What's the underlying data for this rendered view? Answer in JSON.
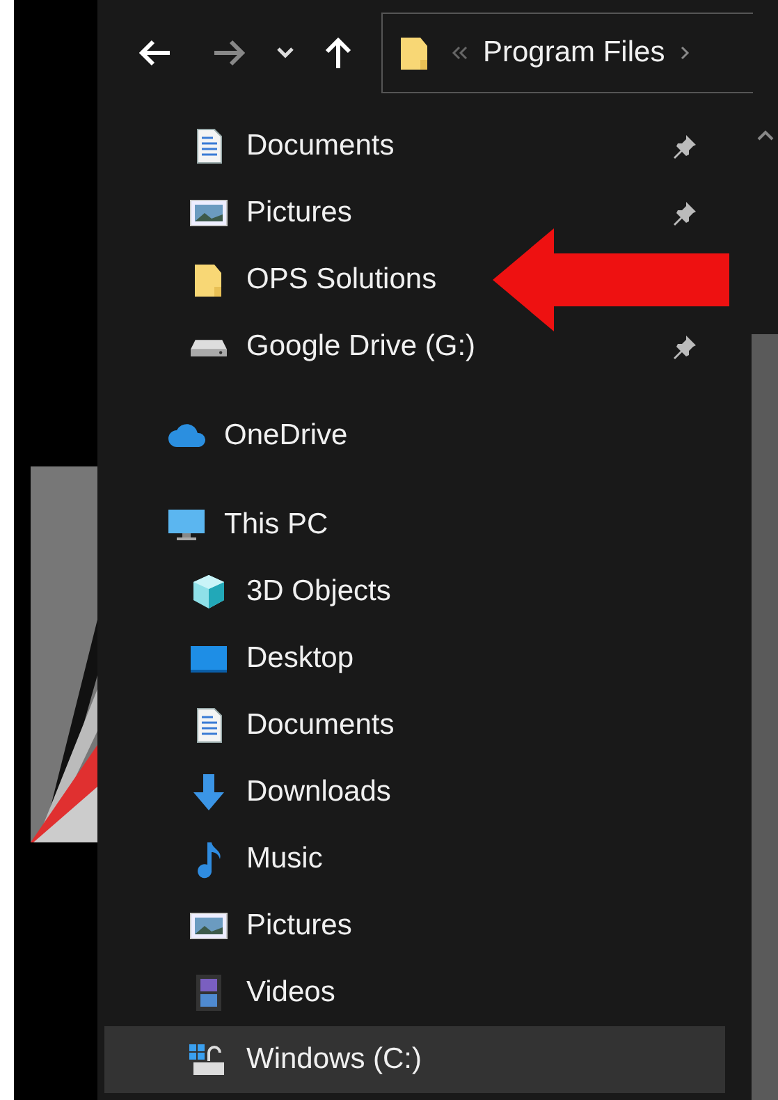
{
  "toolbar": {
    "address": {
      "breadcrumbs": [
        {
          "label": "Program Files"
        }
      ]
    }
  },
  "quick_access": [
    {
      "label": "Documents",
      "kind": "documents",
      "pinned": true,
      "selected": false
    },
    {
      "label": "Pictures",
      "kind": "pictures",
      "pinned": true,
      "selected": false
    },
    {
      "label": "OPS Solutions",
      "kind": "folder",
      "selected": false
    },
    {
      "label": "Google Drive (G:)",
      "kind": "drive",
      "pinned": true,
      "selected": false
    }
  ],
  "nav_tree": [
    {
      "label": "OneDrive",
      "kind": "cloud",
      "selected": false
    },
    {
      "label": "This PC",
      "kind": "pc",
      "selected": false,
      "children": [
        {
          "label": "3D Objects",
          "kind": "cube",
          "selected": false
        },
        {
          "label": "Desktop",
          "kind": "desktop",
          "selected": false
        },
        {
          "label": "Documents",
          "kind": "documents",
          "selected": false
        },
        {
          "label": "Downloads",
          "kind": "downloads",
          "selected": false
        },
        {
          "label": "Music",
          "kind": "music",
          "selected": false
        },
        {
          "label": "Pictures",
          "kind": "pictures",
          "selected": false
        },
        {
          "label": "Videos",
          "kind": "videos",
          "selected": false
        },
        {
          "label": "Windows (C:)",
          "kind": "windows-drive",
          "selected": true
        }
      ]
    }
  ]
}
